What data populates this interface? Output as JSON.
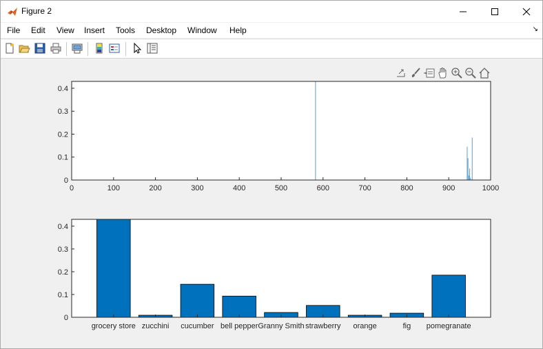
{
  "window": {
    "title": "Figure 2"
  },
  "menu": [
    "File",
    "Edit",
    "View",
    "Insert",
    "Tools",
    "Desktop",
    "Window",
    "Help"
  ],
  "toolbar": {
    "items": [
      "new-figure",
      "open-file",
      "save-figure",
      "print-figure",
      "print-preview",
      "insert-colorbar",
      "insert-legend",
      "edit-plot",
      "property-inspector"
    ]
  },
  "axes_toolbar": {
    "items": [
      "export",
      "brush",
      "data-tips",
      "pan",
      "zoom-in",
      "zoom-out",
      "restore-view"
    ]
  },
  "colors": {
    "bar": "#0072BD",
    "stem": "#4DA0D8"
  },
  "chart_data": [
    {
      "type": "bar",
      "xlim": [
        0,
        1000
      ],
      "ylim": [
        0,
        0.43
      ],
      "xticks": [
        "0",
        "100",
        "200",
        "300",
        "400",
        "500",
        "600",
        "700",
        "800",
        "900",
        "1000"
      ],
      "yticks": [
        "0",
        "0.1",
        "0.2",
        "0.3",
        "0.4"
      ],
      "x": [
        582,
        944,
        946,
        948,
        950,
        952,
        956
      ],
      "values": [
        0.43,
        0.145,
        0.095,
        0.02,
        0.05,
        0.01,
        0.185
      ],
      "grid": false
    },
    {
      "type": "bar",
      "categories": [
        "grocery store",
        "zucchini",
        "cucumber",
        "bell pepper",
        "Granny Smith",
        "strawberry",
        "orange",
        "fig",
        "pomegranate"
      ],
      "values": [
        0.43,
        0.009,
        0.145,
        0.093,
        0.021,
        0.052,
        0.009,
        0.018,
        0.185
      ],
      "ylim": [
        0,
        0.43
      ],
      "yticks": [
        "0",
        "0.1",
        "0.2",
        "0.3",
        "0.4"
      ],
      "grid": false
    }
  ]
}
